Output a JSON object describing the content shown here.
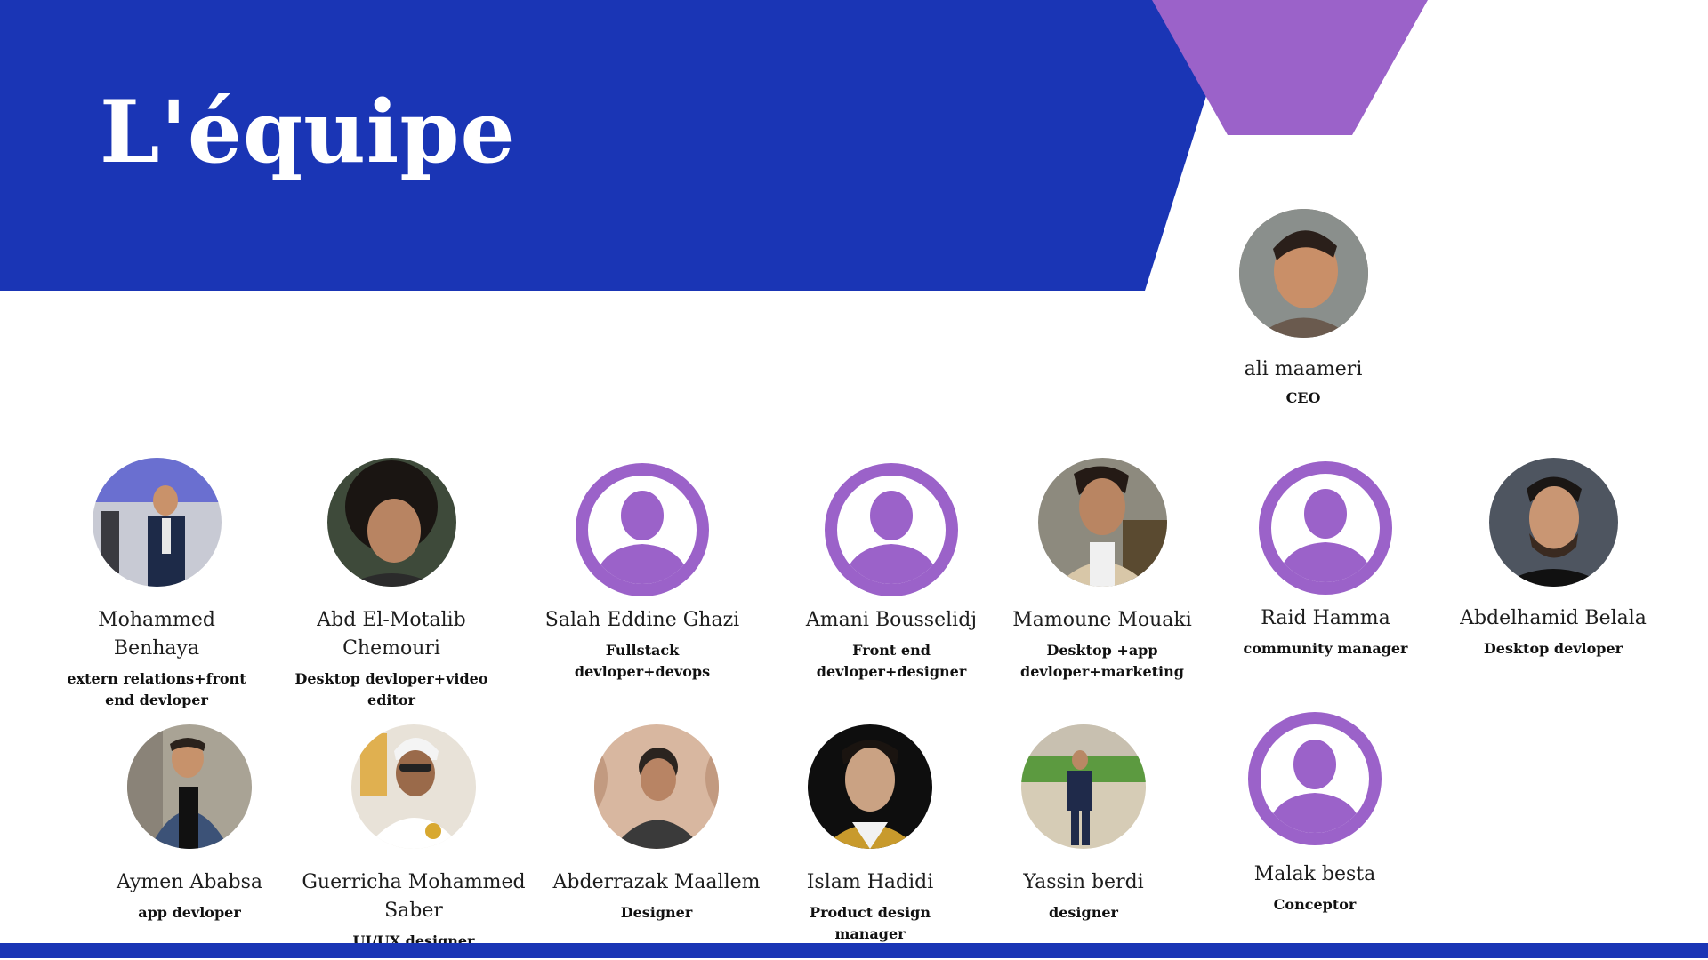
{
  "slide": {
    "title": "L'équipe",
    "colors": {
      "primary": "#1a35b5",
      "accent": "#9b62c9",
      "background": "#ffffff"
    }
  },
  "ceo": {
    "name": "ali maameri",
    "role": "CEO",
    "avatar": "photo"
  },
  "row1": [
    {
      "name": "Mohammed Benhaya",
      "role": "extern relations+front end devloper",
      "avatar": "photo"
    },
    {
      "name": "Abd El-Motalib Chemouri",
      "role": "Desktop devloper+video editor",
      "avatar": "photo"
    },
    {
      "name": "Salah Eddine Ghazi",
      "role": "Fullstack devloper+devops",
      "avatar": "user-placeholder-icon"
    },
    {
      "name": "Amani Bousselidj",
      "role": "Front end devloper+designer",
      "avatar": "user-placeholder-icon"
    },
    {
      "name": "Mamoune Mouaki",
      "role": "Desktop +app devloper+marketing",
      "avatar": "photo"
    },
    {
      "name": "Raid Hamma",
      "role": "community manager",
      "avatar": "user-placeholder-icon"
    },
    {
      "name": "Abdelhamid Belala",
      "role": "Desktop devloper",
      "avatar": "photo"
    }
  ],
  "row2": [
    {
      "name": "Aymen Ababsa",
      "role": "app devloper",
      "avatar": "photo"
    },
    {
      "name": "Guerricha Mohammed Saber",
      "role": "UI/UX designer",
      "avatar": "photo"
    },
    {
      "name": "Abderrazak Maallem",
      "role": "Designer",
      "avatar": "photo"
    },
    {
      "name": "Islam Hadidi",
      "role": "Product design manager",
      "avatar": "photo"
    },
    {
      "name": "Yassin berdi",
      "role": "designer",
      "avatar": "photo"
    },
    {
      "name": "Malak besta",
      "role": "Conceptor",
      "avatar": "user-placeholder-icon"
    }
  ]
}
